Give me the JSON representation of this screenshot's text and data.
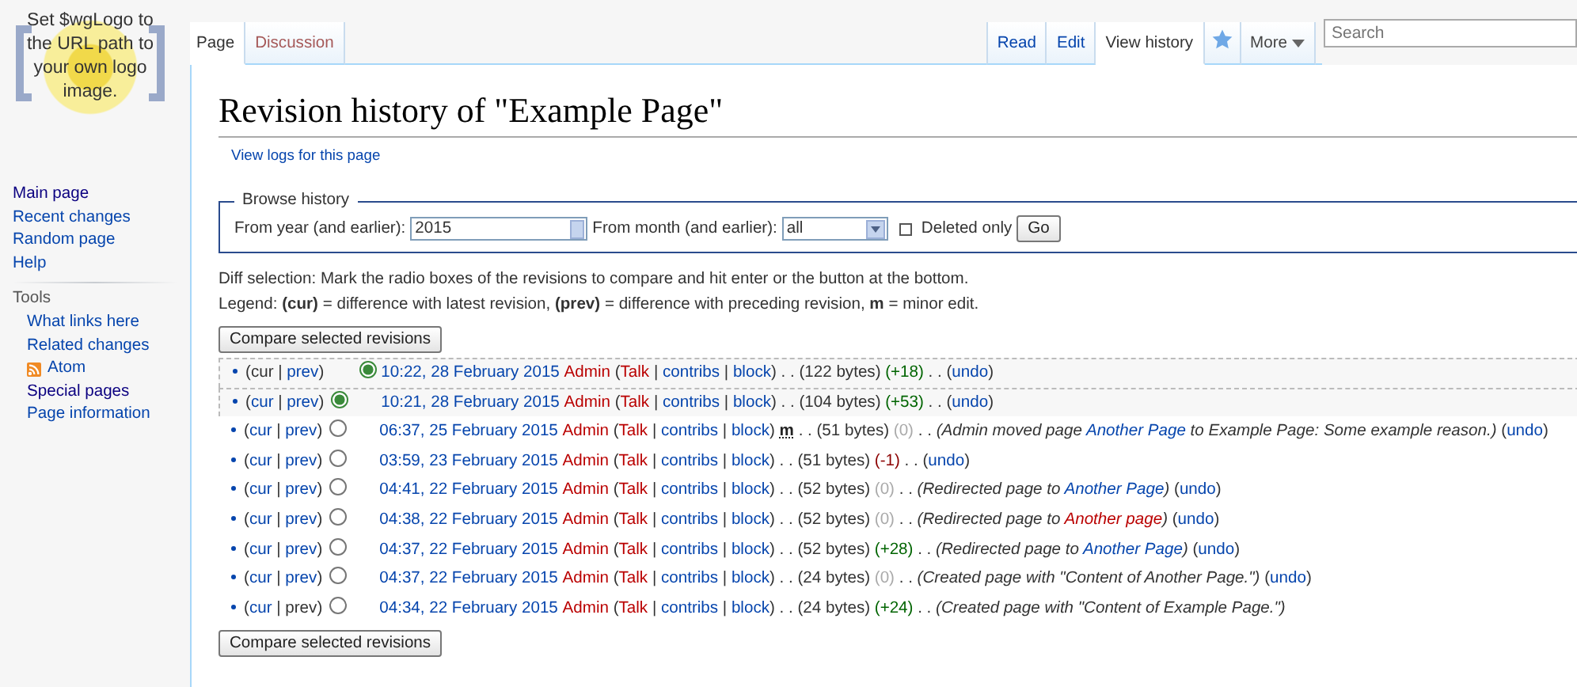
{
  "logo": {
    "text": "Set $wgLogo to the URL path to your own logo image."
  },
  "sidebar": {
    "navigation": [
      {
        "label": "Main page",
        "visited": true
      },
      {
        "label": "Recent changes",
        "visited": false
      },
      {
        "label": "Random page",
        "visited": false
      },
      {
        "label": "Help",
        "visited": false
      }
    ],
    "tools": {
      "heading": "Tools",
      "items": [
        {
          "label": "What links here",
          "kind": "link",
          "visited": false
        },
        {
          "label": "Related changes",
          "kind": "link",
          "visited": false
        },
        {
          "label": "Atom",
          "kind": "feed",
          "visited": false
        },
        {
          "label": "Special pages",
          "kind": "link",
          "visited": true
        },
        {
          "label": "Page information",
          "kind": "link",
          "visited": false
        }
      ]
    }
  },
  "namespace_tabs": [
    {
      "label": "Page",
      "selected": true,
      "missing": false
    },
    {
      "label": "Discussion",
      "selected": false,
      "missing": true
    }
  ],
  "view_tabs": [
    {
      "label": "Read",
      "selected": false
    },
    {
      "label": "Edit",
      "selected": false
    },
    {
      "label": "View history",
      "selected": true
    }
  ],
  "more_menu": {
    "label": "More"
  },
  "search": {
    "placeholder": "Search"
  },
  "title": "Revision history of \"Example Page\"",
  "subtitle_link": "View logs for this page",
  "browse_form": {
    "legend": "Browse history",
    "year_label": "From year (and earlier):",
    "year_value": "2015",
    "month_label": "From month (and earlier):",
    "month_value": "all",
    "deleted_only": {
      "label": "Deleted only",
      "checked": false
    },
    "submit": "Go"
  },
  "instructions": [
    "Diff selection: Mark the radio boxes of the revisions to compare and hit enter or the button at the bottom.",
    "Legend: **(cur)** = difference with latest revision, **(prev)** = difference with preceding revision, **m** = minor edit."
  ],
  "compare_button_top": "Compare selected revisions",
  "history": {
    "rows": [
      {
        "selected": true,
        "segments": [
          {
            "text": "(",
            "kind": "text"
          },
          {
            "text": "cur",
            "kind": "text"
          },
          {
            "text": " | ",
            "kind": "text"
          },
          {
            "text": "prev",
            "kind": "link"
          },
          {
            "text": ")",
            "kind": "text"
          },
          {
            "kind": "slot"
          },
          {
            "kind": "radio",
            "selected": true
          },
          {
            "text": "10:22, 28 February 2015",
            "kind": "timestamp"
          },
          {
            "text": "Admin",
            "kind": "missing"
          },
          {
            "text": " (",
            "kind": "text"
          },
          {
            "text": "Talk",
            "kind": "missing"
          },
          {
            "text": " | ",
            "kind": "text"
          },
          {
            "text": "contribs",
            "kind": "link"
          },
          {
            "text": " | ",
            "kind": "text"
          },
          {
            "text": "block",
            "kind": "link"
          },
          {
            "text": ") . . (122 bytes) ",
            "kind": "text"
          },
          {
            "text": "(+18)",
            "kind": "plus"
          },
          {
            "text": " . . (",
            "kind": "text"
          },
          {
            "text": "undo",
            "kind": "link"
          },
          {
            "text": ")",
            "kind": "text"
          }
        ]
      },
      {
        "selected": true,
        "segments": [
          {
            "text": "(",
            "kind": "text"
          },
          {
            "text": "cur",
            "kind": "link"
          },
          {
            "text": " | ",
            "kind": "text"
          },
          {
            "text": "prev",
            "kind": "link"
          },
          {
            "text": ")",
            "kind": "text"
          },
          {
            "kind": "radio",
            "selected": true
          },
          {
            "kind": "slot"
          },
          {
            "text": "10:21, 28 February 2015",
            "kind": "timestamp"
          },
          {
            "text": "Admin",
            "kind": "missing"
          },
          {
            "text": " (",
            "kind": "text"
          },
          {
            "text": "Talk",
            "kind": "missing"
          },
          {
            "text": " | ",
            "kind": "text"
          },
          {
            "text": "contribs",
            "kind": "link"
          },
          {
            "text": " | ",
            "kind": "text"
          },
          {
            "text": "block",
            "kind": "link"
          },
          {
            "text": ") . . (104 bytes) ",
            "kind": "text"
          },
          {
            "text": "(+53)",
            "kind": "plus"
          },
          {
            "text": " . . (",
            "kind": "text"
          },
          {
            "text": "undo",
            "kind": "link"
          },
          {
            "text": ")",
            "kind": "text"
          }
        ]
      },
      {
        "selected": false,
        "segments": [
          {
            "text": "(",
            "kind": "text"
          },
          {
            "text": "cur",
            "kind": "link"
          },
          {
            "text": " | ",
            "kind": "text"
          },
          {
            "text": "prev",
            "kind": "link"
          },
          {
            "text": ")",
            "kind": "text"
          },
          {
            "kind": "radio",
            "selected": false
          },
          {
            "kind": "slot"
          },
          {
            "text": "06:37, 25 February 2015",
            "kind": "timestamp"
          },
          {
            "text": "Admin",
            "kind": "missing"
          },
          {
            "text": " (",
            "kind": "text"
          },
          {
            "text": "Talk",
            "kind": "missing"
          },
          {
            "text": " | ",
            "kind": "text"
          },
          {
            "text": "contribs",
            "kind": "link"
          },
          {
            "text": " | ",
            "kind": "text"
          },
          {
            "text": "block",
            "kind": "link"
          },
          {
            "text": ") ",
            "kind": "text"
          },
          {
            "text": "m",
            "kind": "minor"
          },
          {
            "text": " . . (51 bytes) ",
            "kind": "text"
          },
          {
            "text": "(0)",
            "kind": "zero"
          },
          {
            "text": " . . ",
            "kind": "text"
          },
          {
            "text": "(Admin moved page ",
            "kind": "comment"
          },
          {
            "text": "Another Page",
            "kind": "comment-link"
          },
          {
            "text": " to Example Page: Some example reason.)",
            "kind": "comment"
          },
          {
            "text": " (",
            "kind": "text"
          },
          {
            "text": "undo",
            "kind": "link"
          },
          {
            "text": ")",
            "kind": "text"
          }
        ]
      },
      {
        "selected": false,
        "segments": [
          {
            "text": "(",
            "kind": "text"
          },
          {
            "text": "cur",
            "kind": "link"
          },
          {
            "text": " | ",
            "kind": "text"
          },
          {
            "text": "prev",
            "kind": "link"
          },
          {
            "text": ")",
            "kind": "text"
          },
          {
            "kind": "radio",
            "selected": false
          },
          {
            "kind": "slot"
          },
          {
            "text": "03:59, 23 February 2015",
            "kind": "timestamp"
          },
          {
            "text": "Admin",
            "kind": "missing"
          },
          {
            "text": " (",
            "kind": "text"
          },
          {
            "text": "Talk",
            "kind": "missing"
          },
          {
            "text": " | ",
            "kind": "text"
          },
          {
            "text": "contribs",
            "kind": "link"
          },
          {
            "text": " | ",
            "kind": "text"
          },
          {
            "text": "block",
            "kind": "link"
          },
          {
            "text": ") . . (51 bytes) ",
            "kind": "text"
          },
          {
            "text": "(-1)",
            "kind": "minus"
          },
          {
            "text": " . . (",
            "kind": "text"
          },
          {
            "text": "undo",
            "kind": "link"
          },
          {
            "text": ")",
            "kind": "text"
          }
        ]
      },
      {
        "selected": false,
        "segments": [
          {
            "text": "(",
            "kind": "text"
          },
          {
            "text": "cur",
            "kind": "link"
          },
          {
            "text": " | ",
            "kind": "text"
          },
          {
            "text": "prev",
            "kind": "link"
          },
          {
            "text": ")",
            "kind": "text"
          },
          {
            "kind": "radio",
            "selected": false
          },
          {
            "kind": "slot"
          },
          {
            "text": "04:41, 22 February 2015",
            "kind": "timestamp"
          },
          {
            "text": "Admin",
            "kind": "missing"
          },
          {
            "text": " (",
            "kind": "text"
          },
          {
            "text": "Talk",
            "kind": "missing"
          },
          {
            "text": " | ",
            "kind": "text"
          },
          {
            "text": "contribs",
            "kind": "link"
          },
          {
            "text": " | ",
            "kind": "text"
          },
          {
            "text": "block",
            "kind": "link"
          },
          {
            "text": ") . . (52 bytes) ",
            "kind": "text"
          },
          {
            "text": "(0)",
            "kind": "zero"
          },
          {
            "text": " . . ",
            "kind": "text"
          },
          {
            "text": "(Redirected page to ",
            "kind": "comment"
          },
          {
            "text": "Another Page",
            "kind": "comment-link"
          },
          {
            "text": ")",
            "kind": "comment"
          },
          {
            "text": " (",
            "kind": "text"
          },
          {
            "text": "undo",
            "kind": "link"
          },
          {
            "text": ")",
            "kind": "text"
          }
        ]
      },
      {
        "selected": false,
        "segments": [
          {
            "text": "(",
            "kind": "text"
          },
          {
            "text": "cur",
            "kind": "link"
          },
          {
            "text": " | ",
            "kind": "text"
          },
          {
            "text": "prev",
            "kind": "link"
          },
          {
            "text": ")",
            "kind": "text"
          },
          {
            "kind": "radio",
            "selected": false
          },
          {
            "kind": "slot"
          },
          {
            "text": "04:38, 22 February 2015",
            "kind": "timestamp"
          },
          {
            "text": "Admin",
            "kind": "missing"
          },
          {
            "text": " (",
            "kind": "text"
          },
          {
            "text": "Talk",
            "kind": "missing"
          },
          {
            "text": " | ",
            "kind": "text"
          },
          {
            "text": "contribs",
            "kind": "link"
          },
          {
            "text": " | ",
            "kind": "text"
          },
          {
            "text": "block",
            "kind": "link"
          },
          {
            "text": ") . . (52 bytes) ",
            "kind": "text"
          },
          {
            "text": "(0)",
            "kind": "zero"
          },
          {
            "text": " . . ",
            "kind": "text"
          },
          {
            "text": "(Redirected page to ",
            "kind": "comment"
          },
          {
            "text": "Another page",
            "kind": "comment-missing"
          },
          {
            "text": ")",
            "kind": "comment"
          },
          {
            "text": " (",
            "kind": "text"
          },
          {
            "text": "undo",
            "kind": "link"
          },
          {
            "text": ")",
            "kind": "text"
          }
        ]
      },
      {
        "selected": false,
        "segments": [
          {
            "text": "(",
            "kind": "text"
          },
          {
            "text": "cur",
            "kind": "link"
          },
          {
            "text": " | ",
            "kind": "text"
          },
          {
            "text": "prev",
            "kind": "link"
          },
          {
            "text": ")",
            "kind": "text"
          },
          {
            "kind": "radio",
            "selected": false
          },
          {
            "kind": "slot"
          },
          {
            "text": "04:37, 22 February 2015",
            "kind": "timestamp"
          },
          {
            "text": "Admin",
            "kind": "missing"
          },
          {
            "text": " (",
            "kind": "text"
          },
          {
            "text": "Talk",
            "kind": "missing"
          },
          {
            "text": " | ",
            "kind": "text"
          },
          {
            "text": "contribs",
            "kind": "link"
          },
          {
            "text": " | ",
            "kind": "text"
          },
          {
            "text": "block",
            "kind": "link"
          },
          {
            "text": ") . . (52 bytes) ",
            "kind": "text"
          },
          {
            "text": "(+28)",
            "kind": "plus"
          },
          {
            "text": " . . ",
            "kind": "text"
          },
          {
            "text": "(Redirected page to ",
            "kind": "comment"
          },
          {
            "text": "Another Page",
            "kind": "comment-link"
          },
          {
            "text": ")",
            "kind": "comment"
          },
          {
            "text": " (",
            "kind": "text"
          },
          {
            "text": "undo",
            "kind": "link"
          },
          {
            "text": ")",
            "kind": "text"
          }
        ]
      },
      {
        "selected": false,
        "segments": [
          {
            "text": "(",
            "kind": "text"
          },
          {
            "text": "cur",
            "kind": "link"
          },
          {
            "text": " | ",
            "kind": "text"
          },
          {
            "text": "prev",
            "kind": "link"
          },
          {
            "text": ")",
            "kind": "text"
          },
          {
            "kind": "radio",
            "selected": false
          },
          {
            "kind": "slot"
          },
          {
            "text": "04:37, 22 February 2015",
            "kind": "timestamp"
          },
          {
            "text": "Admin",
            "kind": "missing"
          },
          {
            "text": " (",
            "kind": "text"
          },
          {
            "text": "Talk",
            "kind": "missing"
          },
          {
            "text": " | ",
            "kind": "text"
          },
          {
            "text": "contribs",
            "kind": "link"
          },
          {
            "text": " | ",
            "kind": "text"
          },
          {
            "text": "block",
            "kind": "link"
          },
          {
            "text": ") . . (24 bytes) ",
            "kind": "text"
          },
          {
            "text": "(0)",
            "kind": "zero"
          },
          {
            "text": " . . ",
            "kind": "text"
          },
          {
            "text": "(Created page with \"Content of Another Page.\")",
            "kind": "comment"
          },
          {
            "text": " (",
            "kind": "text"
          },
          {
            "text": "undo",
            "kind": "link"
          },
          {
            "text": ")",
            "kind": "text"
          }
        ]
      },
      {
        "selected": false,
        "segments": [
          {
            "text": "(",
            "kind": "text"
          },
          {
            "text": "cur",
            "kind": "link"
          },
          {
            "text": " | ",
            "kind": "text"
          },
          {
            "text": "prev",
            "kind": "text"
          },
          {
            "text": ")",
            "kind": "text"
          },
          {
            "kind": "radio",
            "selected": false
          },
          {
            "kind": "slot"
          },
          {
            "text": "04:34, 22 February 2015",
            "kind": "timestamp"
          },
          {
            "text": "Admin",
            "kind": "missing"
          },
          {
            "text": " (",
            "kind": "text"
          },
          {
            "text": "Talk",
            "kind": "missing"
          },
          {
            "text": " | ",
            "kind": "text"
          },
          {
            "text": "contribs",
            "kind": "link"
          },
          {
            "text": " | ",
            "kind": "text"
          },
          {
            "text": "block",
            "kind": "link"
          },
          {
            "text": ") . . (24 bytes) ",
            "kind": "text"
          },
          {
            "text": "(+24)",
            "kind": "plus"
          },
          {
            "text": " . . ",
            "kind": "text"
          },
          {
            "text": "(Created page with \"Content of Example Page.\")",
            "kind": "comment"
          }
        ]
      }
    ]
  },
  "compare_button_bottom": "Compare selected revisions"
}
